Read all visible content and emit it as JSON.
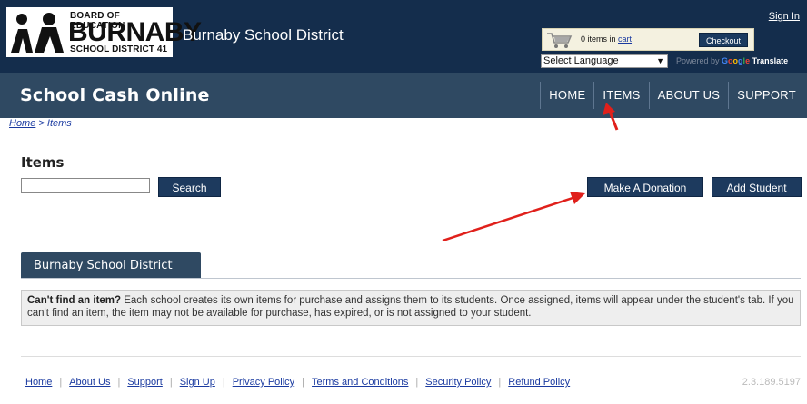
{
  "header": {
    "logo": {
      "line1": "BOARD OF EDUCATION",
      "line2": "BURNABY",
      "line3": "SCHOOL DISTRICT 41"
    },
    "district_title": "Burnaby School District",
    "sign_in": "Sign In",
    "cart": {
      "prefix": "0 items in ",
      "link": "cart",
      "checkout": "Checkout"
    },
    "language": {
      "selected": "Select Language",
      "powered_by": "Powered by ",
      "translate": "Translate"
    }
  },
  "nav": {
    "brand": "School Cash Online",
    "items": [
      "HOME",
      "ITEMS",
      "ABOUT US",
      "SUPPORT"
    ]
  },
  "breadcrumb": {
    "home": "Home",
    "separator": " > ",
    "current": "Items"
  },
  "items": {
    "heading": "Items",
    "search_label": "Search",
    "search_value": "",
    "donate_label": "Make A Donation",
    "add_student_label": "Add Student"
  },
  "tab": {
    "label": "Burnaby School District"
  },
  "info": {
    "bold": "Can't find an item?",
    "text": " Each school creates its own items for purchase and assigns them to its students. Once assigned, items will appear under the student's tab. If you can't find an item, the item may not be available for purchase, has expired, or is not assigned to your student."
  },
  "footer": {
    "links": [
      "Home",
      "About Us",
      "Support",
      "Sign Up",
      "Privacy Policy",
      "Terms and Conditions",
      "Security Policy",
      "Refund Policy"
    ],
    "version": "2.3.189.5197"
  },
  "colors": {
    "header_bg": "#142d4c",
    "nav_bg": "#2f4962",
    "button_bg": "#1d3a5e",
    "annotation_arrow": "#e0201b"
  }
}
